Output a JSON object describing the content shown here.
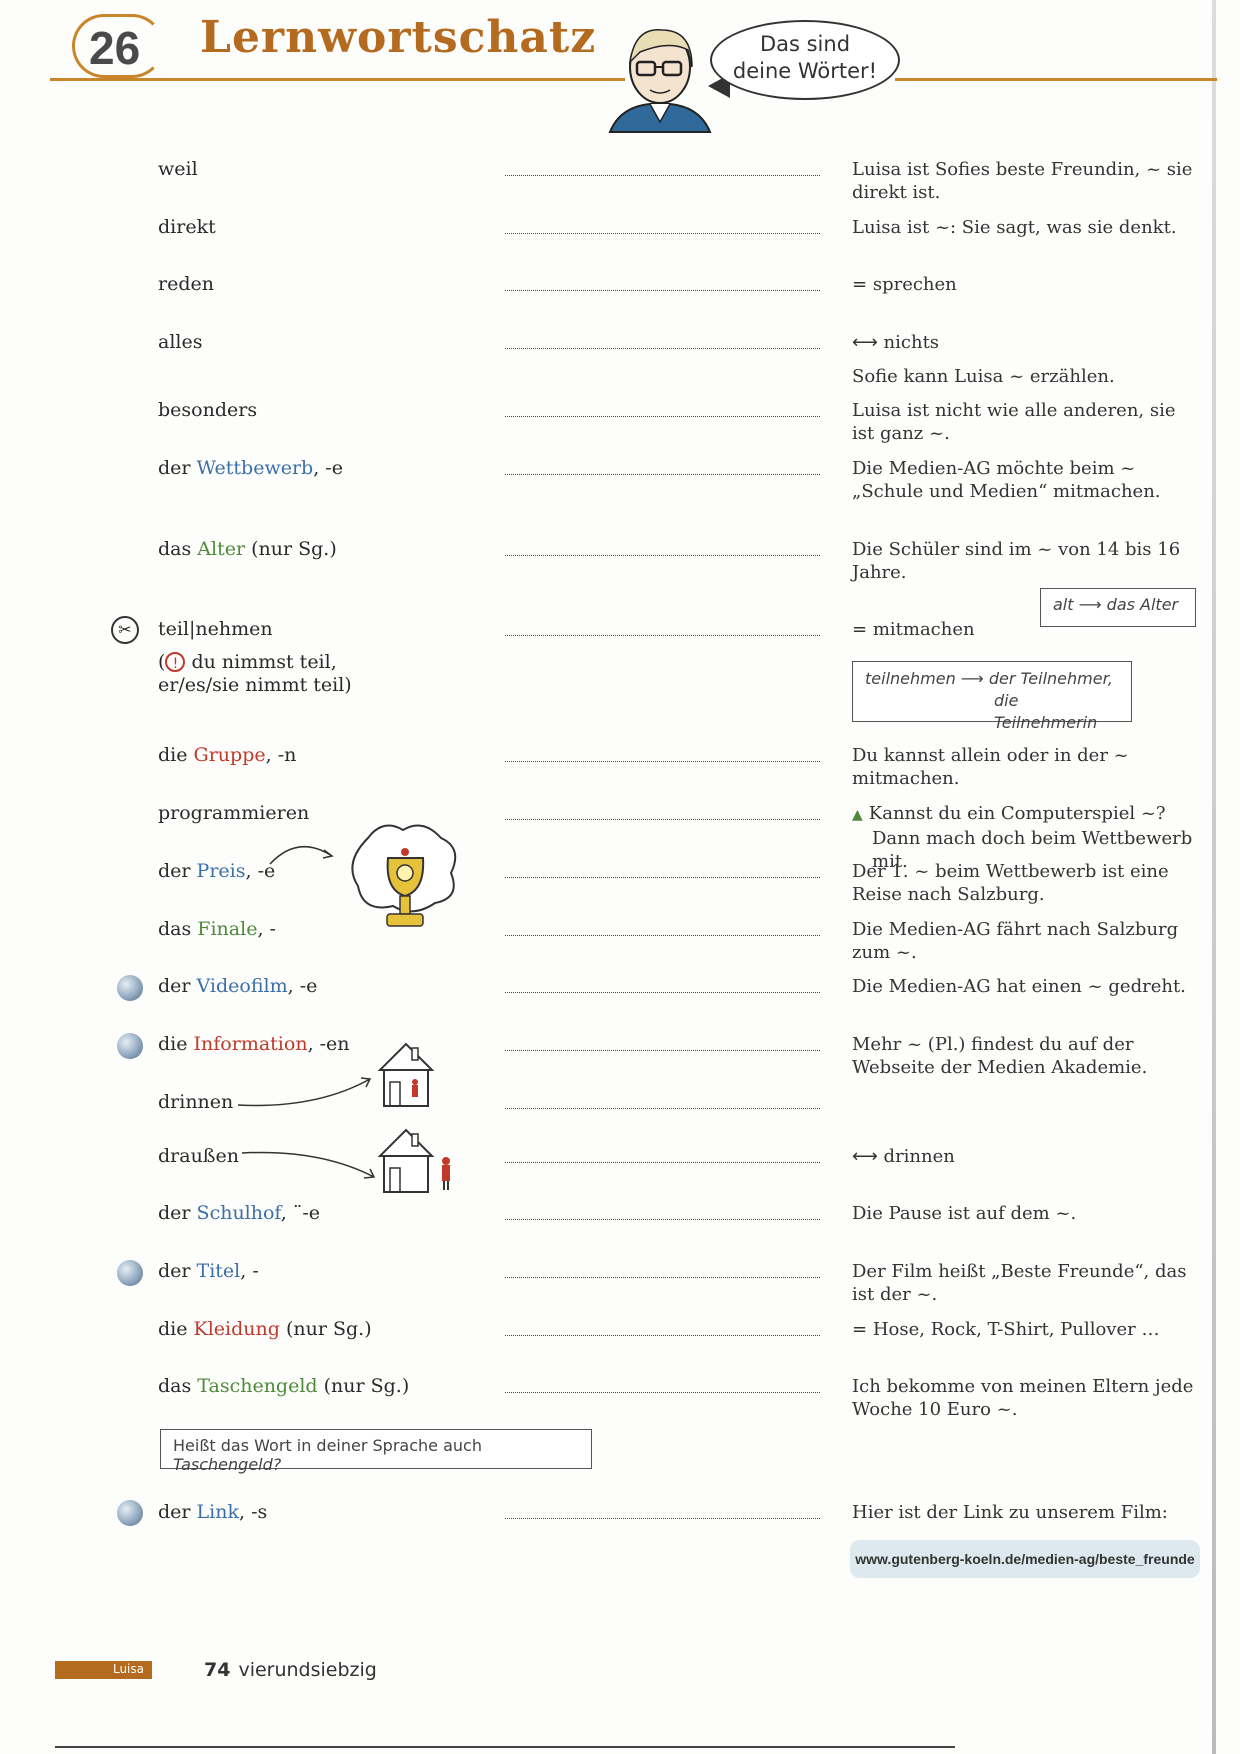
{
  "header": {
    "chapter_number": "26",
    "title": "Lernwortschatz",
    "speech": [
      "Das sind",
      "deine Wörter!"
    ]
  },
  "rows": [
    {
      "term": "weil",
      "example": "Luisa ist Sofies beste Freundin, ~ sie direkt ist."
    },
    {
      "term": "direkt",
      "example": "Luisa ist ~: Sie sagt, was sie denkt."
    },
    {
      "term": "reden",
      "example_symbol": "=",
      "example": "sprechen"
    },
    {
      "term": "alles",
      "example_symbol": "⟷",
      "example": "nichts",
      "example2": "Sofie kann Luisa ~ erzählen."
    },
    {
      "term": "besonders",
      "example": "Luisa ist nicht wie alle anderen, sie ist ganz ~."
    },
    {
      "article": "der",
      "noun": "Wettbewerb",
      "suffix": ", -e",
      "example": "Die Medien-AG möchte beim ~ „Schule und Medien“ mitmachen."
    },
    {
      "article": "das",
      "noun": "Alter",
      "suffix": " (nur Sg.)",
      "example": "Die Schüler sind im ~ von 14 bis 16 Jahre."
    },
    {
      "term": "teil|nehmen",
      "note_line1": "du nimmst teil,",
      "note_line2": "er/es/sie nimmt teil)",
      "example_symbol": "=",
      "example": "mitmachen"
    },
    {
      "article": "die",
      "noun": "Gruppe",
      "suffix": ", -n",
      "example": "Du kannst allein oder in der ~ mitmachen."
    },
    {
      "term": "programmieren",
      "example": "Kannst du ein Computerspiel ~? Dann mach doch beim Wettbewerb mit."
    },
    {
      "article": "der",
      "noun": "Preis",
      "suffix": ", -e",
      "example": "Der 1. ~ beim Wettbewerb ist eine Reise nach Salzburg."
    },
    {
      "article": "das",
      "noun": "Finale",
      "suffix": ", -",
      "example": "Die Medien-AG fährt nach Salzburg zum ~."
    },
    {
      "article": "der",
      "noun": "Videofilm",
      "suffix": ", -e",
      "example": "Die Medien-AG hat einen ~ gedreht."
    },
    {
      "article": "die",
      "noun": "Information",
      "suffix": ", -en",
      "example": "Mehr ~ (Pl.) findest du auf der Webseite der Medien Akademie."
    },
    {
      "term": "drinnen",
      "example": ""
    },
    {
      "term": "draußen",
      "example_symbol": "⟷",
      "example": "drinnen"
    },
    {
      "article": "der",
      "noun": "Schulhof",
      "suffix": ", ¨-e",
      "example": "Die Pause ist auf dem ~."
    },
    {
      "article": "der",
      "noun": "Titel",
      "suffix": ", -",
      "example": "Der Film heißt „Beste Freunde“, das ist der ~."
    },
    {
      "article": "die",
      "noun": "Kleidung",
      "suffix": " (nur Sg.)",
      "example_symbol": "=",
      "example": "Hose, Rock, T-Shirt, Pullover …"
    },
    {
      "article": "das",
      "noun": "Taschengeld",
      "suffix": " (nur Sg.)",
      "example": "Ich bekomme von meinen Eltern jede Woche 10 Euro ~."
    },
    {
      "article": "der",
      "noun": "Link",
      "suffix": ", -s",
      "example": "Hier ist der Link zu unserem Film:"
    }
  ],
  "hints": {
    "alter": {
      "from": "alt",
      "to": "das Alter"
    },
    "teilnehmen": {
      "from": "teilnehmen",
      "to_line1": "der Teilnehmer,",
      "to_line2": "die Teilnehmerin"
    },
    "taschengeld": {
      "text": "Heißt das Wort in deiner Sprache auch ",
      "word": "Taschengeld?"
    }
  },
  "url": "www.gutenberg-koeln.de/medien-ag/beste_freunde",
  "footer": {
    "label": "Luisa",
    "page_number": "74",
    "page_word": "vierundsiebzig"
  },
  "colors": {
    "accent": "#b46a1f",
    "noun_blue": "#3c6fa8",
    "noun_green": "#4e8a3a",
    "noun_red": "#c0392b"
  }
}
